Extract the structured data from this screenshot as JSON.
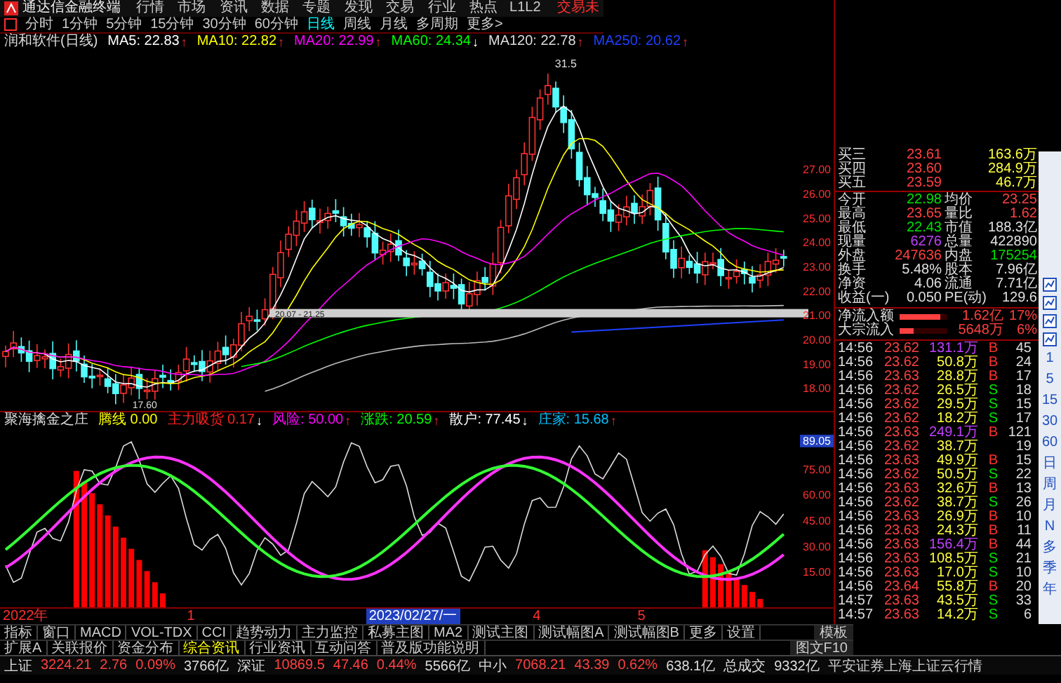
{
  "menu_bar": {
    "app_name": "通达信金融终端",
    "items": [
      "行情",
      "市场",
      "资讯",
      "数据",
      "专题",
      "发现",
      "交易",
      "行业",
      "热点",
      "L1L2"
    ],
    "trade_label": "交易未"
  },
  "period_bar": {
    "items": [
      {
        "label": "分时",
        "selected": false
      },
      {
        "label": "1分钟",
        "selected": false
      },
      {
        "label": "5分钟",
        "selected": false
      },
      {
        "label": "15分钟",
        "selected": false
      },
      {
        "label": "30分钟",
        "selected": false
      },
      {
        "label": "60分钟",
        "selected": false
      },
      {
        "label": "日线",
        "selected": true
      },
      {
        "label": "周线",
        "selected": false
      },
      {
        "label": "月线",
        "selected": false
      },
      {
        "label": "多周期",
        "selected": false
      },
      {
        "label": "更多>",
        "selected": false
      }
    ]
  },
  "ma_legend": {
    "title": "润和软件(日线)",
    "items": [
      {
        "label": "MA5: 22.83",
        "arrow": "↑",
        "kind": "up",
        "color": "#ffffff"
      },
      {
        "label": "MA10: 22.82",
        "arrow": "↑",
        "kind": "up",
        "color": "#ffff00"
      },
      {
        "label": "MA20: 22.99",
        "arrow": "↑",
        "kind": "up",
        "color": "#ff00ff"
      },
      {
        "label": "MA60: 24.34",
        "arrow": "↓",
        "kind": "down",
        "color": "#00ff00"
      },
      {
        "label": "MA120: 22.78",
        "arrow": "↑",
        "kind": "up",
        "color": "#dddddd"
      },
      {
        "label": "MA250: 20.62",
        "arrow": "↑",
        "kind": "up",
        "color": "#2040ff"
      }
    ]
  },
  "price_chart": {
    "high_label": "31.5",
    "low_label": "17.60",
    "band_label": "20.07 - 21.25",
    "axis": [
      "27.00",
      "26.00",
      "25.00",
      "24.00",
      "23.00",
      "22.00",
      "21.00",
      "20.00",
      "19.00",
      "18.00"
    ]
  },
  "indicator": {
    "name": "聚海擒金之庄",
    "items": [
      {
        "label": "腾线",
        "value": "0.00",
        "color": "#ffff00"
      },
      {
        "label": "主力吸货",
        "value": "0.17",
        "arrow": "↓",
        "kind": "down",
        "color": "#ff2020"
      },
      {
        "label": "风险:",
        "value": "50.00",
        "arrow": "↑",
        "kind": "up",
        "color": "#ff00ff"
      },
      {
        "label": "涨跌:",
        "value": "20.59",
        "arrow": "↑",
        "kind": "up",
        "color": "#00ff00"
      },
      {
        "label": "散户:",
        "value": "77.45",
        "arrow": "↓",
        "kind": "down",
        "color": "#ffffff"
      },
      {
        "label": "庄家:",
        "value": "15.68",
        "arrow": "↑",
        "kind": "up",
        "color": "#00c0ff"
      }
    ],
    "axis": [
      {
        "label": "89.05",
        "kind": "marker"
      },
      {
        "label": "75.00",
        "kind": "tick"
      },
      {
        "label": "60.00",
        "kind": "tick"
      },
      {
        "label": "45.00",
        "kind": "tick"
      },
      {
        "label": "30.00",
        "kind": "tick"
      },
      {
        "label": "15.00",
        "kind": "tick"
      }
    ]
  },
  "date_axis": [
    {
      "label": "2022年",
      "kind": "tick"
    },
    {
      "label": "1",
      "kind": "tick"
    },
    {
      "label": "2023/02/27/一",
      "kind": "cursor"
    },
    {
      "label": "4",
      "kind": "tick"
    },
    {
      "label": "5",
      "kind": "tick"
    }
  ],
  "quote_panel": {
    "bids": [
      {
        "label": "买三",
        "price": "23.61",
        "volume": "163.6万"
      },
      {
        "label": "买四",
        "price": "23.60",
        "volume": "284.9万"
      },
      {
        "label": "买五",
        "price": "23.59",
        "volume": "46.7万"
      }
    ],
    "stats": [
      {
        "cells": [
          {
            "label": "今开",
            "value": "22.98",
            "color": "#00e000"
          },
          {
            "label": "均价",
            "value": "23.25",
            "color": "#ff4040"
          }
        ]
      },
      {
        "cells": [
          {
            "label": "最高",
            "value": "23.65",
            "color": "#ff4040"
          },
          {
            "label": "量比",
            "value": "1.62",
            "color": "#ff4040"
          }
        ]
      },
      {
        "cells": [
          {
            "label": "最低",
            "value": "22.43",
            "color": "#00e000"
          },
          {
            "label": "市值",
            "value": "188.3亿",
            "color": "#e0e0e0"
          }
        ]
      },
      {
        "cells": [
          {
            "label": "现量",
            "value": "6276",
            "color": "#c040ff"
          },
          {
            "label": "总量",
            "value": "422890",
            "color": "#e0e0e0"
          }
        ]
      },
      {
        "cells": [
          {
            "label": "外盘",
            "value": "247636",
            "color": "#ff4040"
          },
          {
            "label": "内盘",
            "value": "175254",
            "color": "#00e000"
          }
        ]
      },
      {
        "cells": [
          {
            "label": "换手",
            "value": "5.48%",
            "color": "#e0e0e0"
          },
          {
            "label": "股本",
            "value": "7.96亿",
            "color": "#e0e0e0"
          }
        ]
      },
      {
        "cells": [
          {
            "label": "净资",
            "value": "4.06",
            "color": "#e0e0e0"
          },
          {
            "label": "流通",
            "value": "7.71亿",
            "color": "#e0e0e0"
          }
        ]
      },
      {
        "cells": [
          {
            "label": "收益(一)",
            "value": "0.050",
            "color": "#e0e0e0"
          },
          {
            "label": "PE(动)",
            "value": "129.6",
            "color": "#e0e0e0"
          }
        ]
      }
    ],
    "flows": [
      {
        "label": "净流入额",
        "level": 0.85,
        "value": "1.62亿",
        "pct": "17%"
      },
      {
        "label": "大宗流入",
        "level": 0.3,
        "value": "5648万",
        "pct": "6%"
      }
    ],
    "ticks": [
      {
        "time": "14:56",
        "price": "23.62",
        "volume": "131.1万",
        "big": true,
        "side": "B",
        "kind": "buy",
        "count": "45"
      },
      {
        "time": "14:56",
        "price": "23.62",
        "volume": "50.8万",
        "big": false,
        "side": "B",
        "kind": "buy",
        "count": "24"
      },
      {
        "time": "14:56",
        "price": "23.63",
        "volume": "28.8万",
        "big": false,
        "side": "B",
        "kind": "buy",
        "count": "17"
      },
      {
        "time": "14:56",
        "price": "23.62",
        "volume": "26.5万",
        "big": false,
        "side": "S",
        "kind": "sell",
        "count": "18"
      },
      {
        "time": "14:56",
        "price": "23.62",
        "volume": "29.5万",
        "big": false,
        "side": "S",
        "kind": "sell",
        "count": "15"
      },
      {
        "time": "14:56",
        "price": "23.62",
        "volume": "18.2万",
        "big": false,
        "side": "S",
        "kind": "sell",
        "count": "17"
      },
      {
        "time": "14:56",
        "price": "23.63",
        "volume": "249.1万",
        "big": true,
        "side": "B",
        "kind": "buy",
        "count": "121"
      },
      {
        "time": "14:56",
        "price": "23.62",
        "volume": "38.7万",
        "big": false,
        "count": "19"
      },
      {
        "time": "14:56",
        "price": "23.63",
        "volume": "49.9万",
        "big": false,
        "side": "B",
        "kind": "buy",
        "count": "15"
      },
      {
        "time": "14:56",
        "price": "23.62",
        "volume": "50.5万",
        "big": false,
        "side": "S",
        "kind": "sell",
        "count": "22"
      },
      {
        "time": "14:56",
        "price": "23.63",
        "volume": "32.6万",
        "big": false,
        "side": "B",
        "kind": "buy",
        "count": "13"
      },
      {
        "time": "14:56",
        "price": "23.62",
        "volume": "38.7万",
        "big": false,
        "side": "S",
        "kind": "sell",
        "count": "26"
      },
      {
        "time": "14:56",
        "price": "23.63",
        "volume": "26.9万",
        "big": false,
        "side": "B",
        "kind": "buy",
        "count": "10"
      },
      {
        "time": "14:56",
        "price": "23.63",
        "volume": "24.3万",
        "big": false,
        "side": "B",
        "kind": "buy",
        "count": "11"
      },
      {
        "time": "14:56",
        "price": "23.63",
        "volume": "156.4万",
        "big": true,
        "side": "B",
        "kind": "buy",
        "count": "44"
      },
      {
        "time": "14:56",
        "price": "23.63",
        "volume": "108.5万",
        "big": false,
        "side": "S",
        "kind": "sell",
        "count": "21"
      },
      {
        "time": "14:56",
        "price": "23.63",
        "volume": "17.0万",
        "big": false,
        "side": "S",
        "kind": "sell",
        "count": "10"
      },
      {
        "time": "14:56",
        "price": "23.64",
        "volume": "55.8万",
        "big": false,
        "side": "B",
        "kind": "buy",
        "count": "20"
      },
      {
        "time": "14:57",
        "price": "23.63",
        "volume": "43.5万",
        "big": false,
        "side": "S",
        "kind": "sell",
        "count": "33"
      },
      {
        "time": "14:57",
        "price": "23.63",
        "volume": "14.2万",
        "big": false,
        "side": "S",
        "kind": "sell",
        "count": "6"
      }
    ]
  },
  "side_toolbar": {
    "items": [
      "1",
      "5",
      "15",
      "30",
      "60",
      "日",
      "周",
      "月",
      "N",
      "多",
      "季",
      "年"
    ]
  },
  "tabs_row1": {
    "items": [
      {
        "label": "指标",
        "selected": false
      },
      {
        "label": "窗口",
        "selected": false
      },
      {
        "label": "MACD",
        "selected": false
      },
      {
        "label": "VOL-TDX",
        "selected": false
      },
      {
        "label": "CCI",
        "selected": false
      },
      {
        "label": "趋势动力",
        "selected": false
      },
      {
        "label": "主力监控",
        "selected": false
      },
      {
        "label": "私募主图",
        "selected": false
      },
      {
        "label": "MA2",
        "selected": false
      },
      {
        "label": "测试主图",
        "selected": false
      },
      {
        "label": "测试幅图A",
        "selected": false
      },
      {
        "label": "测试幅图B",
        "selected": false
      },
      {
        "label": "更多",
        "selected": false
      },
      {
        "label": "设置",
        "selected": false
      }
    ],
    "right": "模板"
  },
  "tabs_row2": {
    "items": [
      {
        "label": "扩展A",
        "selected": false
      },
      {
        "label": "关联报价",
        "selected": false
      },
      {
        "label": "资金分布",
        "selected": false
      },
      {
        "label": "综合资讯",
        "selected": true
      },
      {
        "label": "行业资讯",
        "selected": false
      },
      {
        "label": "互动问答",
        "selected": false
      },
      {
        "label": "普及版功能说明",
        "selected": false
      }
    ],
    "right": "图文F10"
  },
  "ticker": {
    "indices": [
      {
        "name": "上证",
        "value": "3224.21",
        "change": "2.76",
        "pct": "0.09%",
        "amount": "3766亿"
      },
      {
        "name": "深证",
        "value": "10869.5",
        "change": "47.46",
        "pct": "0.44%",
        "amount": "5566亿"
      },
      {
        "name": "中小",
        "value": "7068.21",
        "change": "43.39",
        "pct": "0.62%",
        "amount": "638.1亿"
      }
    ],
    "total_label": "总成交",
    "total_value": "9332亿",
    "source": "平安证券上海上证云行情"
  }
}
